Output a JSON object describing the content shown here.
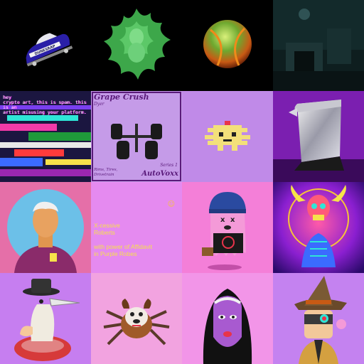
{
  "gallery": {
    "items": [
      {
        "name": "dunesrap-car",
        "label": "DUNESRAP"
      },
      {
        "name": "green-splat-figure"
      },
      {
        "name": "glowing-ball"
      },
      {
        "name": "haunted-room"
      },
      {
        "name": "glitch-art",
        "text": "hey\ncrypto art, this is spam. this is an\nartist misusing your platform."
      },
      {
        "name": "grape-crush",
        "title": "Grape Crush",
        "subtitle": "Dyer",
        "series": "Series 1",
        "brand": "AutoVoxx",
        "credits": "Rims, Tires,\nDrivetrain"
      },
      {
        "name": "pixel-axolotl"
      },
      {
        "name": "chrome-scroll"
      },
      {
        "name": "portrait-man"
      },
      {
        "name": "xcessive-roberts",
        "emoji": "☺",
        "text": "X-cessive\nRoberts\n\nwith power of Affidavit\nin Purple Robes"
      },
      {
        "name": "anarchy-ghost"
      },
      {
        "name": "neon-skeleton"
      },
      {
        "name": "bird-hat"
      },
      {
        "name": "spider-dog"
      },
      {
        "name": "hooded-woman"
      },
      {
        "name": "witch-robot"
      }
    ]
  }
}
